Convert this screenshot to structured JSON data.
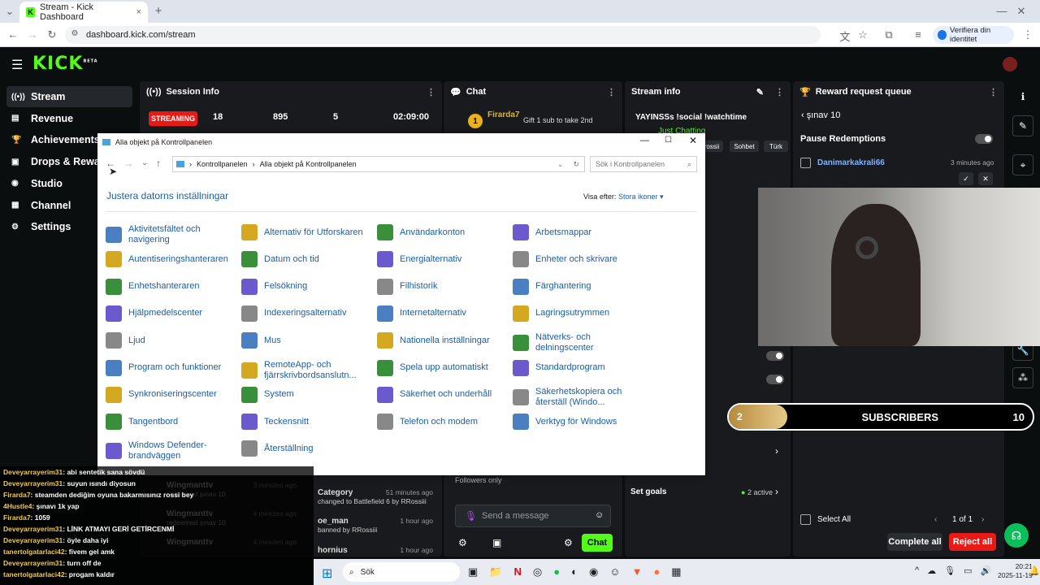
{
  "browser": {
    "tab_title": "Stream - Kick Dashboard",
    "url": "dashboard.kick.com/stream",
    "verify": "Verifiera din identitet",
    "new_tab": "+",
    "close": "×"
  },
  "kick": {
    "logo": "KICK",
    "beta": "BETA"
  },
  "sidebar": {
    "items": [
      {
        "label": "Stream",
        "icon": "((•))"
      },
      {
        "label": "Revenue",
        "icon": "▤"
      },
      {
        "label": "Achievements",
        "icon": "🏆"
      },
      {
        "label": "Drops & Rewards",
        "icon": "▣"
      },
      {
        "label": "Studio",
        "icon": "◉"
      },
      {
        "label": "Channel",
        "icon": "▦"
      },
      {
        "label": "Settings",
        "icon": "⚙"
      }
    ]
  },
  "session": {
    "title": "Session Info",
    "status": "STREAMING",
    "stats": [
      "18",
      "895",
      "5",
      "02:09:00"
    ]
  },
  "chat_panel": {
    "title": "Chat",
    "user": "Firarda7",
    "gift": "Gift 1 sub to take 2nd",
    "followers_only": "Followers only",
    "placeholder": "Send a message",
    "chat_button": "Chat"
  },
  "stream_info": {
    "title": "Stream info",
    "stream_title": "YAYINSSs !social !watchtime",
    "category": "Just Chatting",
    "tags": [
      "rossii",
      "Sohbet",
      "Türk"
    ],
    "set_goals": "Set goals",
    "active": "2 active"
  },
  "reward": {
    "title": "Reward request queue",
    "back_label": "şınav 10",
    "pause": "Pause Redemptions",
    "user": "Danimarkakrali66",
    "time": "3 minutes ago",
    "select_all": "Select All",
    "pager": "1 of 1",
    "complete_all": "Complete all",
    "reject_all": "Reject all"
  },
  "subs_bar": {
    "left": "2",
    "label": "SUBSCRIBERS",
    "right": "10"
  },
  "window": {
    "title": "Alla objekt på Kontrollpanelen",
    "crumb1": "Kontrollpanelen",
    "crumb2": "Alla objekt på Kontrollpanelen",
    "search": "Sök i Kontrollpanelen",
    "heading": "Justera datorns inställningar",
    "view_label": "Visa efter:",
    "view_value": "Stora ikoner",
    "items": [
      [
        "Aktivitetsfältet och navigering",
        "Alternativ för Utforskaren",
        "Användarkonton",
        "Arbetsmappar"
      ],
      [
        "Autentiseringshanteraren",
        "Datum och tid",
        "Energialternativ",
        "Enheter och skrivare"
      ],
      [
        "Enhetshanteraren",
        "Felsökning",
        "Filhistorik",
        "Färghantering"
      ],
      [
        "Hjälpmedelscenter",
        "Indexeringsalternativ",
        "Internetalternativ",
        "Lagringsutrymmen"
      ],
      [
        "Ljud",
        "Mus",
        "Nationella inställningar",
        "Nätverks- och delningscenter"
      ],
      [
        "Program och funktioner",
        "RemoteApp- och fjärrskrivbordsanslutn...",
        "Spela upp automatiskt",
        "Standardprogram"
      ],
      [
        "Synkroniseringscenter",
        "System",
        "Säkerhet och underhåll",
        "Säkerhetskopiera och återställ (Windo..."
      ],
      [
        "Tangentbord",
        "Teckensnitt",
        "Telefon och modem",
        "Verktyg för Windows"
      ],
      [
        "Windows Defender-brandväggen",
        "Återställning",
        "",
        ""
      ]
    ]
  },
  "chatlog": [
    {
      "u": "Deveyarrayerim31",
      "m": ": abi sentetik sana sövdü"
    },
    {
      "u": "Deveyarrayerim31",
      "m": ": suyun ısındı diyosun"
    },
    {
      "u": "Firarda7",
      "m": ": steamden dediğim oyuna bakarmısınız rossi bey"
    },
    {
      "u": "4Hustle4",
      "m": ": şınavı 1k yap"
    },
    {
      "u": "Firarda7",
      "m": ": 1059"
    },
    {
      "u": "Deveyarrayerim31",
      "m": ": LİNK ATMAYI GERİ GETİRCENMİ"
    },
    {
      "u": "Deveyarrayerim31",
      "m": ": öyle daha iyi"
    },
    {
      "u": "tanertolgatarlaci42",
      "m": ": fivem gel amk"
    },
    {
      "u": "Deveyarrayerim31",
      "m": ": turn off de"
    },
    {
      "u": "tanertolgatarlaci42",
      "m": ": progam kaldır"
    }
  ],
  "feed": [
    {
      "u": "Wingmanttv",
      "t": "3 minutes ago",
      "d": "redeemed şınav 10"
    },
    {
      "u": "Wingmanttv",
      "t": "4 minutes ago",
      "d": "redeemed şınav 10"
    },
    {
      "u": "Wingmanttv",
      "t": "4 minutes ago",
      "d": ""
    },
    {
      "u": "Category",
      "t": "51 minutes ago",
      "d": "changed to Battlefield 6 by RRossiii"
    },
    {
      "u": "oe_man",
      "t": "1 hour ago",
      "d": "banned by RRossiii"
    },
    {
      "u": "hornius",
      "t": "1 hour ago",
      "d": ""
    }
  ],
  "taskbar": {
    "search": "Sök",
    "time": "20:21",
    "date": "2025-11-19"
  }
}
